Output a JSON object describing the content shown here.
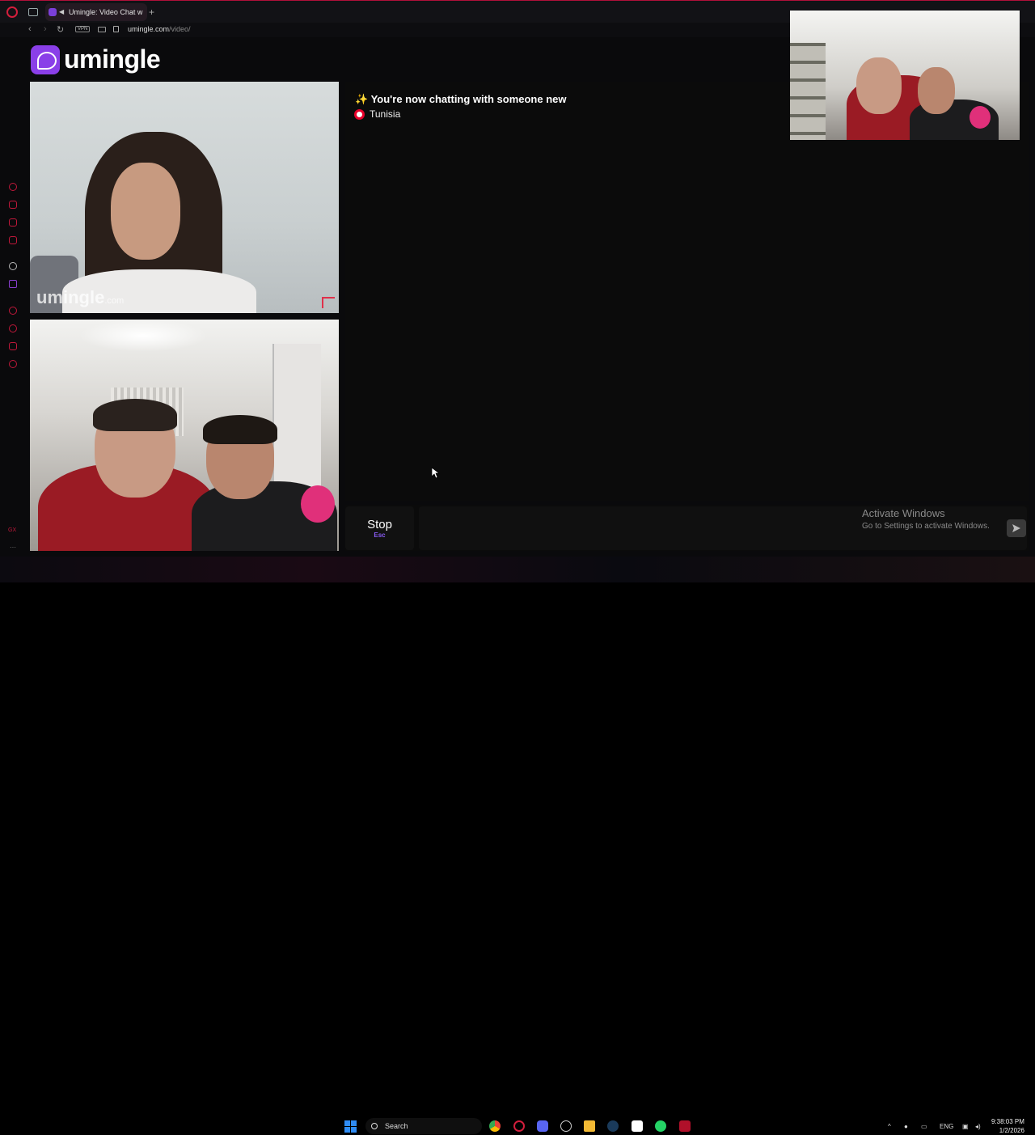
{
  "browser": {
    "tab_title": "Umingle: Video Chat w",
    "new_tab": "+",
    "url_host": "umingle.com",
    "url_path": "/video/",
    "vpn_label": "VPN",
    "sidebar_gx": "GX"
  },
  "site": {
    "logo_text": "umingle"
  },
  "video": {
    "watermark": "umingle",
    "watermark_tld": ".com"
  },
  "chat": {
    "status_icon": "✨",
    "status_message": "You're now chatting with someone new",
    "country": "Tunisia"
  },
  "controls": {
    "stop_label": "Stop",
    "stop_shortcut": "Esc",
    "message_placeholder": ""
  },
  "windows": {
    "activate_title": "Activate Windows",
    "activate_subtitle": "Go to Settings to activate Windows."
  },
  "taskbar": {
    "search_label": "Search",
    "language": "ENG",
    "time": "9:38:03 PM",
    "date": "1/2/2026"
  },
  "colors": {
    "accent": "#8a3fe8",
    "opera_red": "#d21e3c",
    "windows_blue": "#2f8cf5"
  }
}
